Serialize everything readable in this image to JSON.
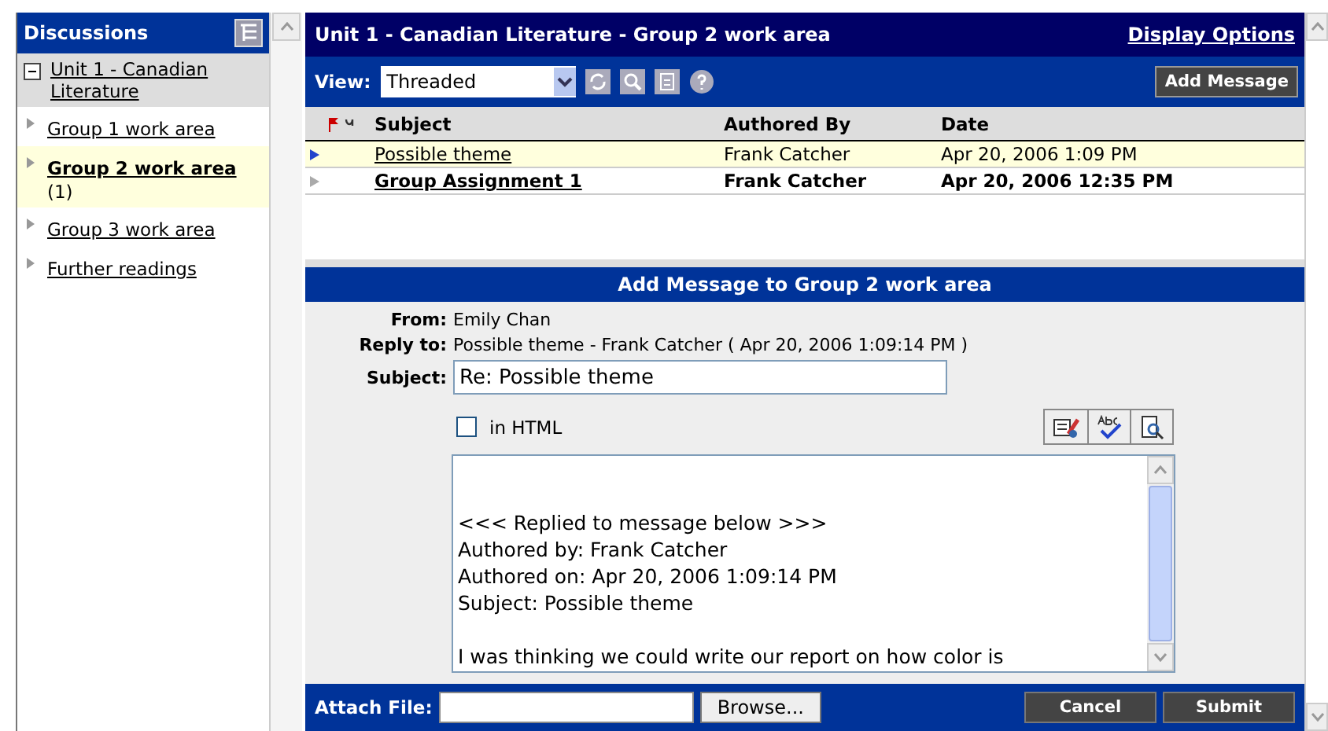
{
  "sidebar": {
    "title": "Discussions",
    "tree": [
      {
        "label": "Unit 1 - Canadian Literature",
        "expanded": true,
        "selected": false,
        "children": [
          {
            "label": "Group 1 work area",
            "selected": false
          },
          {
            "label": "Group 2 work area",
            "count": "(1)",
            "selected": true
          },
          {
            "label": "Group 3 work area",
            "selected": false
          },
          {
            "label": "Further readings",
            "selected": false
          }
        ]
      }
    ]
  },
  "header": {
    "title": "Unit 1 - Canadian Literature - Group 2 work area",
    "link": "Display Options"
  },
  "toolbar": {
    "view_label": "View:",
    "view_value": "Threaded",
    "add_button": "Add Message"
  },
  "table": {
    "columns": [
      "Subject",
      "Authored By",
      "Date"
    ],
    "rows": [
      {
        "subject": "Possible theme",
        "author": "Frank Catcher",
        "date": "Apr 20, 2006 1:09 PM",
        "selected": true,
        "unread": false
      },
      {
        "subject": "Group Assignment 1",
        "author": "Frank Catcher",
        "date": "Apr 20, 2006 12:35 PM",
        "selected": false,
        "unread": true
      }
    ]
  },
  "form": {
    "title": "Add Message to Group 2 work area",
    "fields": [
      {
        "label": "From:",
        "value": "Emily Chan"
      },
      {
        "label": "Reply to:",
        "value": "Possible theme - Frank Catcher ( Apr 20, 2006 1:09:14 PM )"
      }
    ],
    "subject_label": "Subject:",
    "subject_value": "Re: Possible theme",
    "html_label": "in HTML",
    "html_checked": false,
    "body": "\n\n<<< Replied to message below >>>\nAuthored by: Frank Catcher\nAuthored on: Apr 20, 2006 1:09:14 PM\nSubject: Possible theme\n\nI was thinking we could write our report on how color is"
  },
  "footer": {
    "attach_label": "Attach File:",
    "browse_button": "Browse...",
    "buttons": [
      "Cancel",
      "Submit"
    ]
  }
}
